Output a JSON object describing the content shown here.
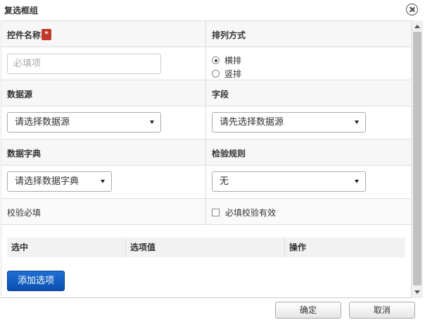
{
  "dialog": {
    "title": "复选框组",
    "close_icon": "close-circle-icon"
  },
  "form": {
    "control_name": {
      "label": "控件名称",
      "required_badge": "*",
      "placeholder": "必填项",
      "value": ""
    },
    "layout": {
      "label": "排列方式",
      "options": [
        {
          "label": "横排",
          "checked": true
        },
        {
          "label": "竖排",
          "checked": false
        }
      ]
    },
    "data_source": {
      "label": "数据源",
      "selected": "请选择数据源"
    },
    "field": {
      "label": "字段",
      "selected": "请先选择数据源"
    },
    "data_dictionary": {
      "label": "数据字典",
      "selected": "请选择数据字典"
    },
    "validation_rule": {
      "label": "检验规则",
      "selected": "无"
    },
    "validation_required": {
      "label": "校验必填",
      "checkbox_label": "必填校验有效",
      "checked": false
    }
  },
  "options_table": {
    "columns": [
      "选中",
      "选项值",
      "操作"
    ],
    "add_button_label": "添加选项"
  },
  "footer": {
    "confirm_label": "确定",
    "cancel_label": "取消"
  },
  "colors": {
    "primary_button": "#1560c8",
    "required_badge": "#c0392b"
  }
}
